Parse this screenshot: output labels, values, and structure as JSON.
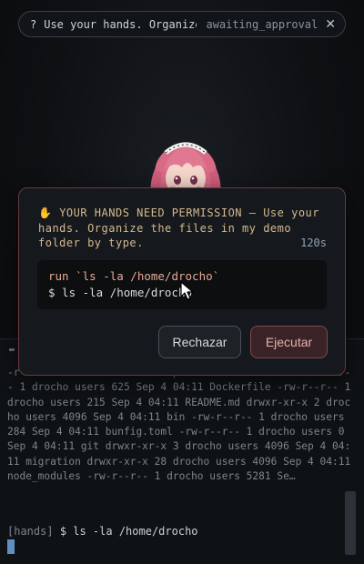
{
  "status": {
    "icon": "question-icon",
    "task_text": "Use your hands. Organize t…",
    "state": "awaiting_approval",
    "close_label": "✕"
  },
  "dialog": {
    "hand_icon": "✋",
    "header_text": "YOUR HANDS NEED PERMISSION — Use your hands. Organize the files in my demo folder by type.",
    "timer": "120s",
    "command_run": "run `ls -la /home/drocho`",
    "command_shell": "$ ls -la /home/drocho",
    "reject_label": "Rechazar",
    "execute_label": "Ejecutar"
  },
  "terminal": {
    "output": "-r-- 1 drocho users 6450 Sep 4 04:11 AGENTS.md -rw-r--r-- 1 drocho users 625 Sep 4 04:11 Dockerfile -rw-r--r-- 1 drocho users 215 Sep 4 04:11 README.md drwxr-xr-x 2 drocho users 4096 Sep 4 04:11 bin -rw-r--r-- 1 drocho users 284 Sep 4 04:11 bunfig.toml -rw-r--r-- 1 drocho users 0 Sep 4 04:11 git drwxr-xr-x 3 drocho users 4096 Sep 4 04:11 migration drwxr-xr-x 28 drocho users 4096 Sep 4 04:11 node_modules -rw-r--r-- 1 drocho users 5281 Se…",
    "prompt_tag": "[hands]",
    "prompt_command": "$ ls -la /home/drocho"
  },
  "colors": {
    "dialog_border": "#6a3a3f",
    "header_text": "#d4b98f",
    "command_run": "#e7a995",
    "execute_button": "#3a2326"
  }
}
